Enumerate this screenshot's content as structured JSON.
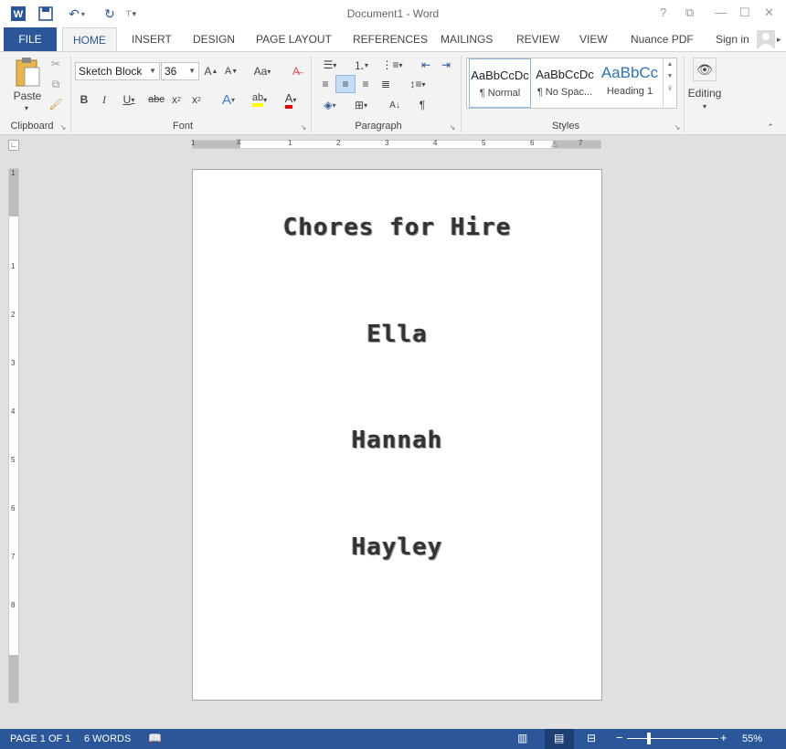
{
  "title": "Document1 - Word",
  "tabs": [
    "FILE",
    "HOME",
    "INSERT",
    "DESIGN",
    "PAGE LAYOUT",
    "REFERENCES",
    "MAILINGS",
    "REVIEW",
    "VIEW",
    "Nuance PDF"
  ],
  "sign_in": "Sign in",
  "ribbon": {
    "clipboard": {
      "paste_label": "Paste",
      "group_label": "Clipboard"
    },
    "font": {
      "name": "Sketch Block",
      "size": "36",
      "group_label": "Font"
    },
    "paragraph": {
      "group_label": "Paragraph"
    },
    "styles": {
      "group_label": "Styles",
      "items": [
        {
          "sample": "AaBbCcDc",
          "name": "¶ Normal"
        },
        {
          "sample": "AaBbCcDc",
          "name": "¶ No Spac..."
        },
        {
          "sample": "AaBbCc",
          "name": "Heading 1"
        }
      ]
    },
    "editing": {
      "label": "Editing"
    }
  },
  "ruler": {
    "h_marks": [
      "1",
      "1",
      "2",
      "3",
      "4",
      "5",
      "6",
      "7"
    ],
    "v_marks": [
      "1",
      "1",
      "2",
      "3",
      "4",
      "5",
      "6",
      "7",
      "8"
    ]
  },
  "document": {
    "lines": [
      "Chores for Hire",
      "Ella",
      "Hannah",
      "Hayley"
    ]
  },
  "status": {
    "page": "PAGE 1 OF 1",
    "words": "6 WORDS",
    "zoom": "55%"
  },
  "colors": {
    "accent": "#2b579a"
  }
}
